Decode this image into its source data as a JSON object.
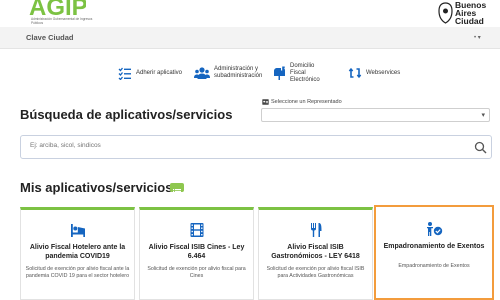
{
  "header": {
    "agency_logo_text": "AGIP",
    "agency_subtitle": "Administración Gubernamental de Ingresos Públicos",
    "city_logo_text": "Buenos\nAires\nCiudad"
  },
  "subnav": {
    "title": "Clave Ciudad",
    "user_menu_glyph": "• ▾"
  },
  "quick_links": [
    {
      "label": "Adherir aplicativo",
      "icon": "checklist-icon"
    },
    {
      "label": "Administración y subadministración",
      "icon": "users-icon"
    },
    {
      "label": "Domicilio Fiscal Electrónico",
      "icon": "mailbox-icon"
    },
    {
      "label": "Webservices",
      "icon": "sync-icon"
    }
  ],
  "search_section": {
    "title": "Búsqueda de aplicativos/servicios",
    "representative_label": "Seleccione un Representado",
    "representative_value": "",
    "search_placeholder": "Ej: arciba, sicol, sindicos"
  },
  "apps_section": {
    "title": "Mis aplicativos/servicios"
  },
  "cards": [
    {
      "title": "Alivio Fiscal Hotelero ante la pandemia COVID19",
      "description": "Solicitud de exención por alivio fiscal ante la pandemia COVID 19 para el sector hotelero",
      "icon": "hotel-icon"
    },
    {
      "title": "Alivio Fiscal ISIB Cines - Ley 6.464",
      "description": "Solicitud de exención por alivio fiscal para Cines",
      "icon": "film-icon"
    },
    {
      "title": "Alivio Fiscal ISIB Gastronómicos - LEY 6418",
      "description": "Solicitud de exención por alivio fiscal ISIB para Actividades Gastronómicas",
      "icon": "cutlery-icon"
    },
    {
      "title": "Empadronamiento de Exentos",
      "description": "Empadronamiento de Exentos",
      "icon": "person-check-icon"
    }
  ],
  "colors": {
    "agency_green": "#7cc243",
    "primary_blue": "#1565c0",
    "highlight_orange": "#f39c3c"
  }
}
